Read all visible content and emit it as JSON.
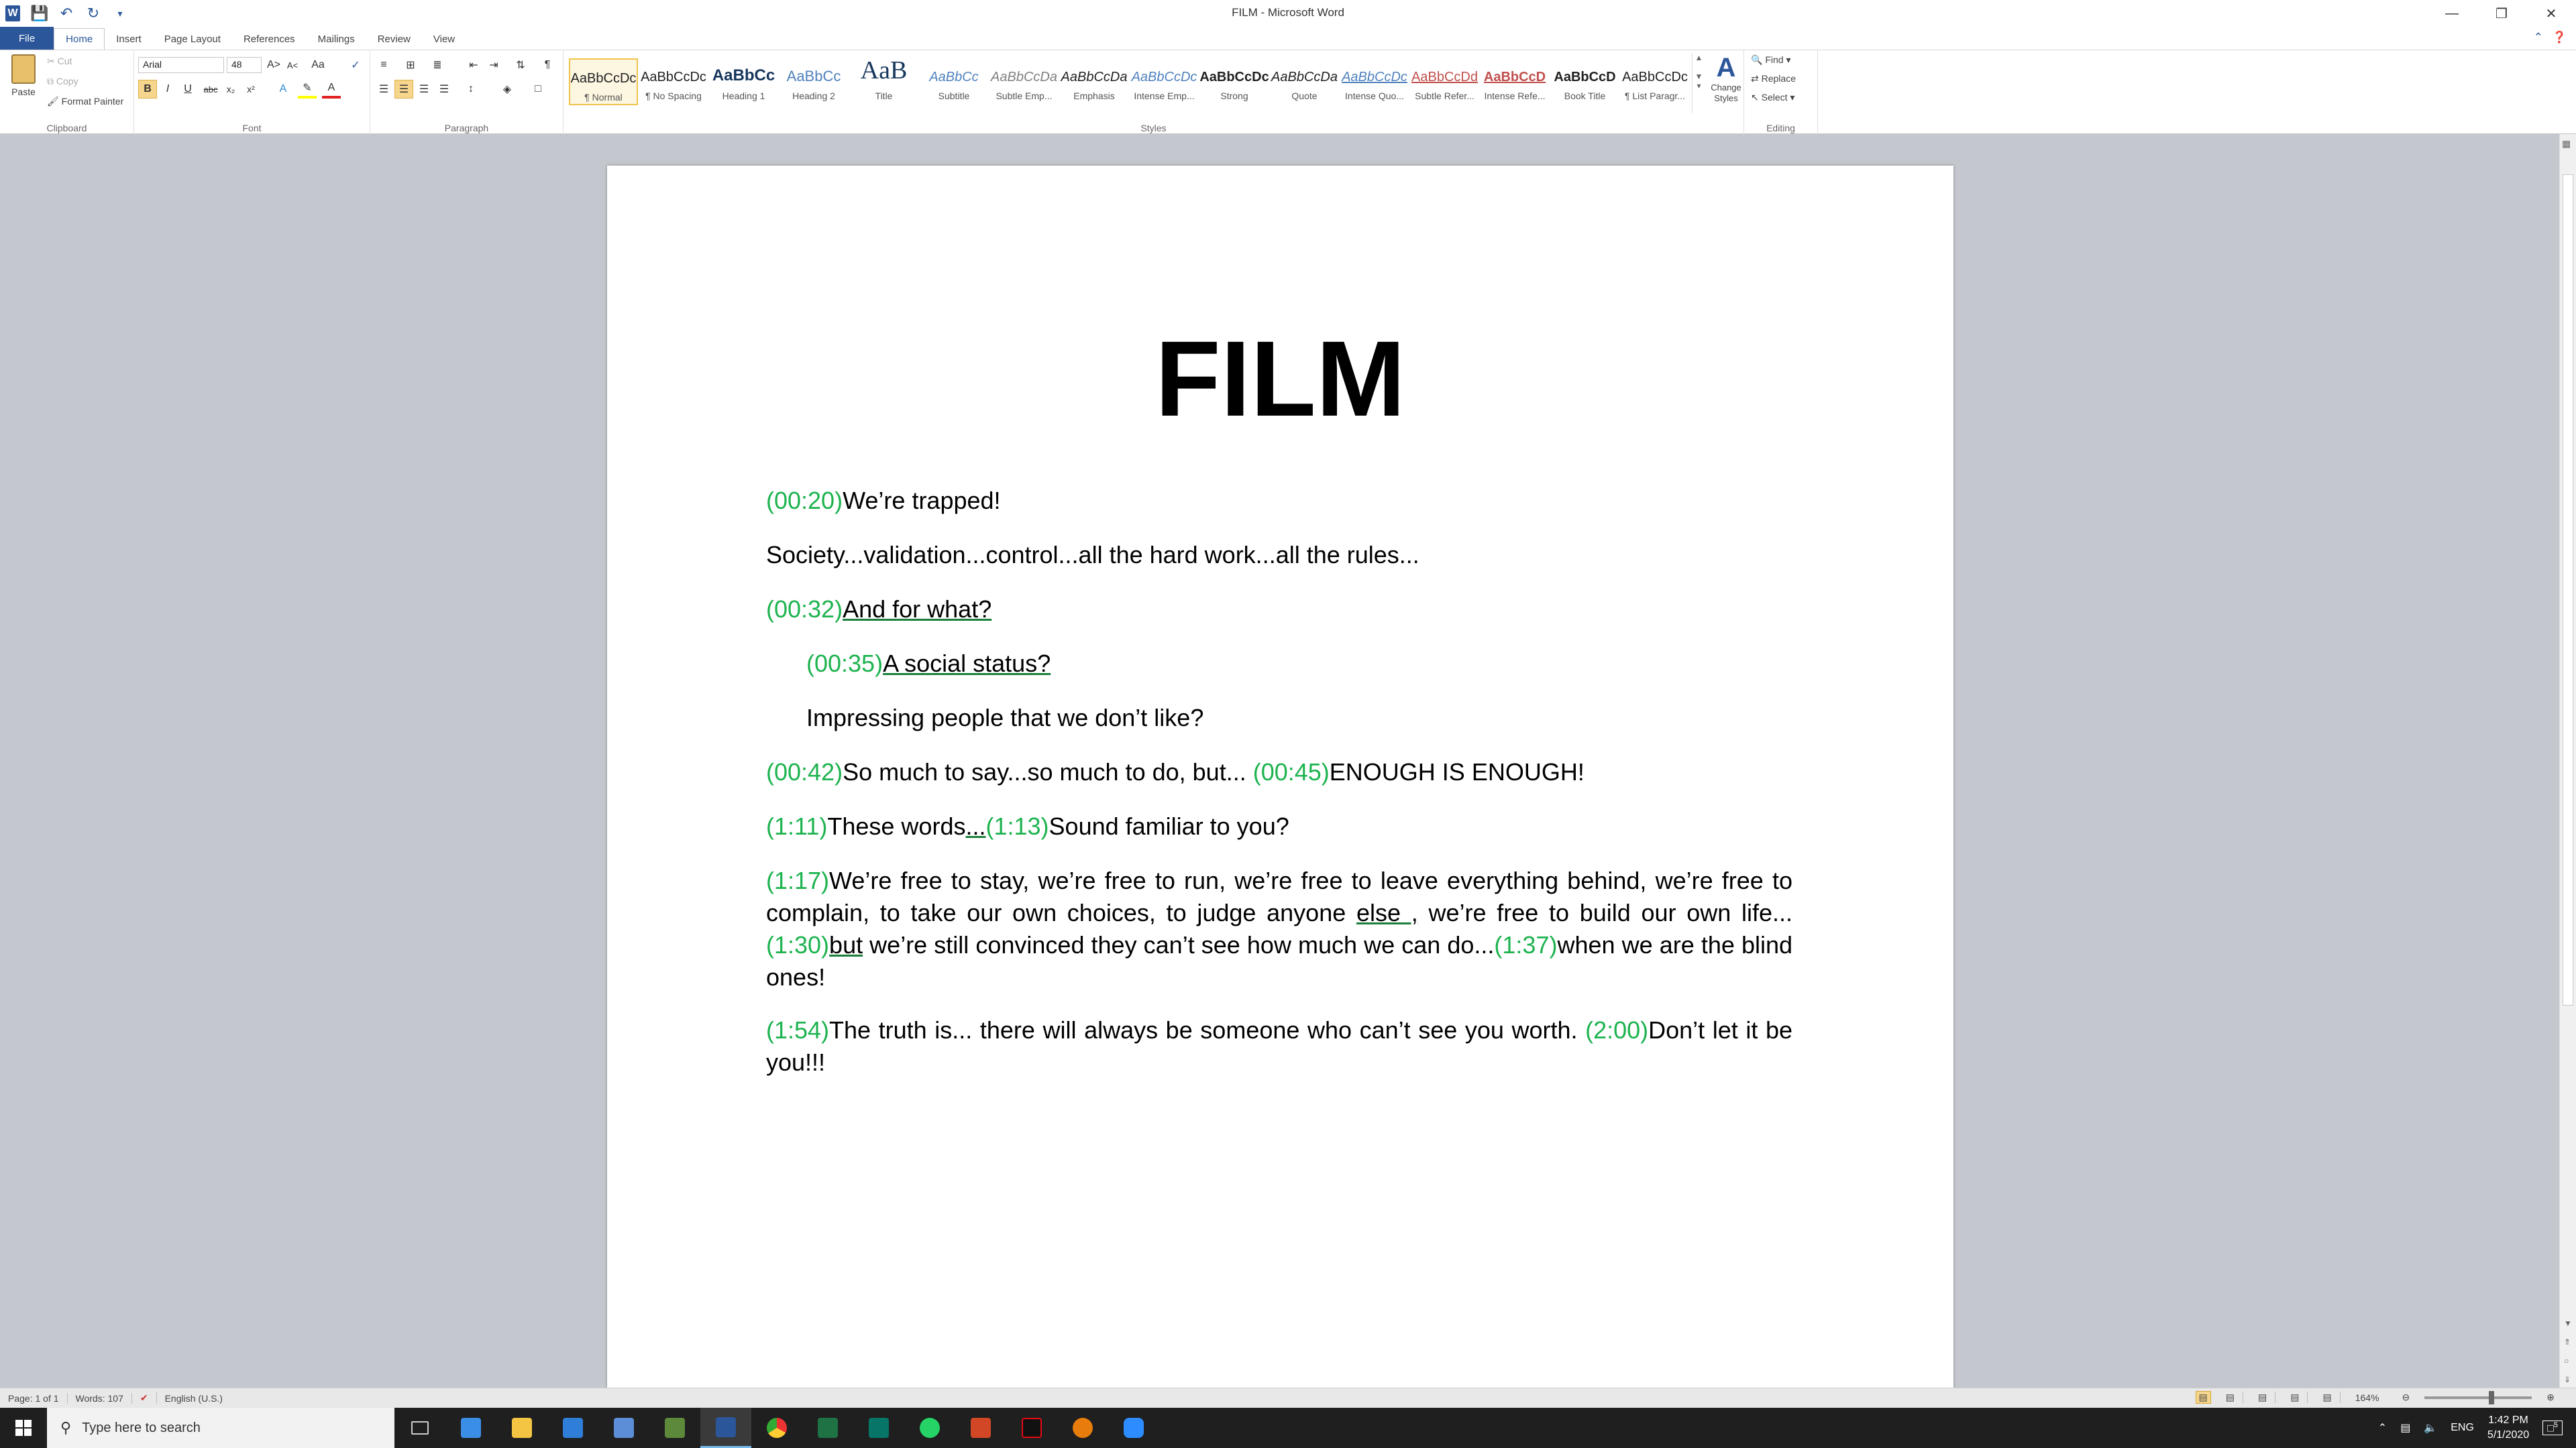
{
  "window": {
    "title": "FILM - Microsoft Word"
  },
  "menu": {
    "file": "File",
    "tabs": [
      "Home",
      "Insert",
      "Page Layout",
      "References",
      "Mailings",
      "Review",
      "View"
    ],
    "active": "Home"
  },
  "clipboard": {
    "paste": "Paste",
    "cut": "Cut",
    "copy": "Copy",
    "format_painter": "Format Painter",
    "label": "Clipboard"
  },
  "font": {
    "name": "Arial",
    "size": "48",
    "label": "Font"
  },
  "paragraph": {
    "label": "Paragraph"
  },
  "styles": {
    "label": "Styles",
    "items": [
      {
        "preview": "AaBbCcDc",
        "name": "¶ Normal"
      },
      {
        "preview": "AaBbCcDc",
        "name": "¶ No Spacing"
      },
      {
        "preview": "AaBbCc",
        "name": "Heading 1"
      },
      {
        "preview": "AaBbCc",
        "name": "Heading 2"
      },
      {
        "preview": "AaB",
        "name": "Title"
      },
      {
        "preview": "AaBbCc",
        "name": "Subtitle"
      },
      {
        "preview": "AaBbCcDa",
        "name": "Subtle Emp..."
      },
      {
        "preview": "AaBbCcDa",
        "name": "Emphasis"
      },
      {
        "preview": "AaBbCcDc",
        "name": "Intense Emp..."
      },
      {
        "preview": "AaBbCcDc",
        "name": "Strong"
      },
      {
        "preview": "AaBbCcDa",
        "name": "Quote"
      },
      {
        "preview": "AaBbCcDc",
        "name": "Intense Quo..."
      },
      {
        "preview": "AaBbCcDd",
        "name": "Subtle Refer..."
      },
      {
        "preview": "AaBbCcD",
        "name": "Intense Refe..."
      },
      {
        "preview": "AaBbCcD",
        "name": "Book Title"
      },
      {
        "preview": "AaBbCcDc",
        "name": "¶ List Paragr..."
      }
    ],
    "change": "Change Styles"
  },
  "editing": {
    "find": "Find",
    "replace": "Replace",
    "select": "Select",
    "label": "Editing"
  },
  "document": {
    "title": "FILM",
    "paragraphs": {
      "p1_ts": "(00:20)",
      "p1_text": "We’re trapped!",
      "p2_text": "Society...validation...control...all the hard work...all the rules...",
      "p3_ts": "(00:32)",
      "p3_text": "And for what?",
      "p4_ts": "(00:35)",
      "p4_text": "A social status?",
      "p5_text": "Impressing people that we don’t like?",
      "p6_ts1": "(00:42)",
      "p6_text1": "So much to say...so much to do, but... ",
      "p6_ts2": "(00:45)",
      "p6_text2": "ENOUGH IS ENOUGH!",
      "p7_ts1": "(1:11)",
      "p7_text1": "These words",
      "p7_text1b": "...",
      "p7_ts2": "(1:13)",
      "p7_text2": "Sound familiar to you?",
      "p8_ts1": "(1:17)",
      "p8_text1": "We’re free to stay, we’re free to run, we’re free to leave everything behind, we’re free to complain, to take our own choices, to judge anyone ",
      "p8_else": "else ,",
      "p8_text1b": " we’re free to build our own life... ",
      "p8_ts2": "(1:30)",
      "p8_but": "but",
      "p8_text2": " we’re still convinced they can’t see how much we can do...",
      "p8_ts3": "(1:37)",
      "p8_text3": "when we are the blind ones!",
      "p9_ts1": "(1:54)",
      "p9_text1": "The truth is... there will always be someone who can’t see you worth. ",
      "p9_ts2": "(2:00)",
      "p9_text2": "Don’t let it be you!!!"
    }
  },
  "status": {
    "page": "Page: 1 of 1",
    "words": "Words: 107",
    "lang": "English (U.S.)",
    "zoom": "164%"
  },
  "taskbar": {
    "search": "Type here to search",
    "lang": "ENG",
    "time": "1:42 PM",
    "date": "5/1/2020",
    "notif": "5"
  },
  "colors": {
    "accent": "#2b579a",
    "timestamp": "#1db34f"
  }
}
